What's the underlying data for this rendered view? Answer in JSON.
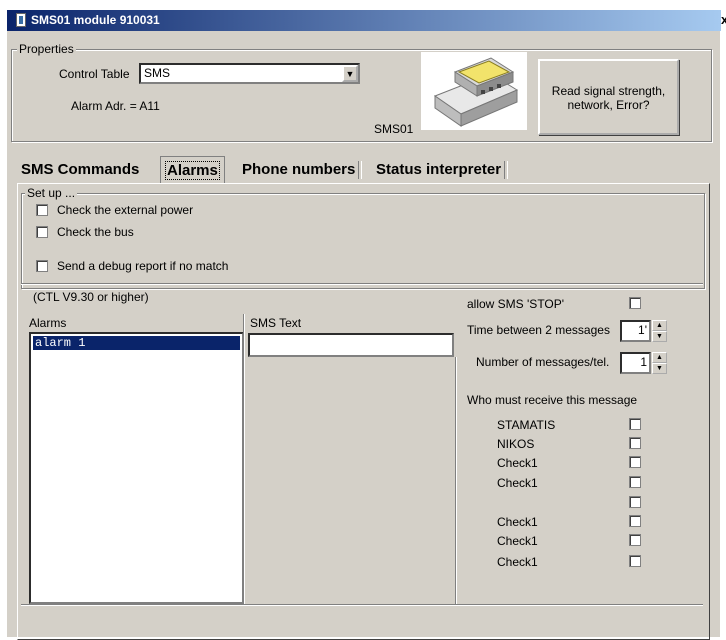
{
  "window": {
    "title": "SMS01 module 910031",
    "close_glyph": "x"
  },
  "properties": {
    "group_label": "Properties",
    "control_table_label": "Control Table",
    "control_table_value": "SMS",
    "alarm_addr": "Alarm Adr. = A11",
    "device_caption": "SMS01",
    "read_button_line1": "Read signal strength,",
    "read_button_line2": "network, Error?"
  },
  "tabs": [
    {
      "label": "SMS Commands",
      "selected": false
    },
    {
      "label": "Alarms",
      "selected": true
    },
    {
      "label": "Phone numbers",
      "selected": false
    },
    {
      "label": "Status interpreter",
      "selected": false
    }
  ],
  "setup": {
    "group_label": "Set up ...",
    "options": [
      {
        "label": "Check the external power",
        "checked": false
      },
      {
        "label": "Check the bus",
        "checked": false
      },
      {
        "label": "Send a debug report if no match",
        "checked": false
      }
    ]
  },
  "alarms": {
    "version_note": "(CTL V9.30 or higher)",
    "list_header": "Alarms",
    "items": [
      "alarm 1"
    ],
    "sms_text_header": "SMS Text",
    "sms_text_value": ""
  },
  "settings": {
    "allow_stop_label": "allow SMS 'STOP'",
    "allow_stop_checked": false,
    "time_between_label": "Time between 2 messages",
    "time_between_value": "1'",
    "num_messages_label": "Number of messages/tel.",
    "num_messages_value": "1",
    "who_receives_label": "Who must receive this message",
    "recipients": [
      {
        "name": "STAMATIS",
        "checked": false
      },
      {
        "name": "NIKOS",
        "checked": false
      },
      {
        "name": "Check1",
        "checked": false
      },
      {
        "name": "Check1",
        "checked": false
      },
      {
        "name": "",
        "checked": false
      },
      {
        "name": "Check1",
        "checked": false
      },
      {
        "name": "Check1",
        "checked": false
      },
      {
        "name": "Check1",
        "checked": false
      }
    ]
  }
}
